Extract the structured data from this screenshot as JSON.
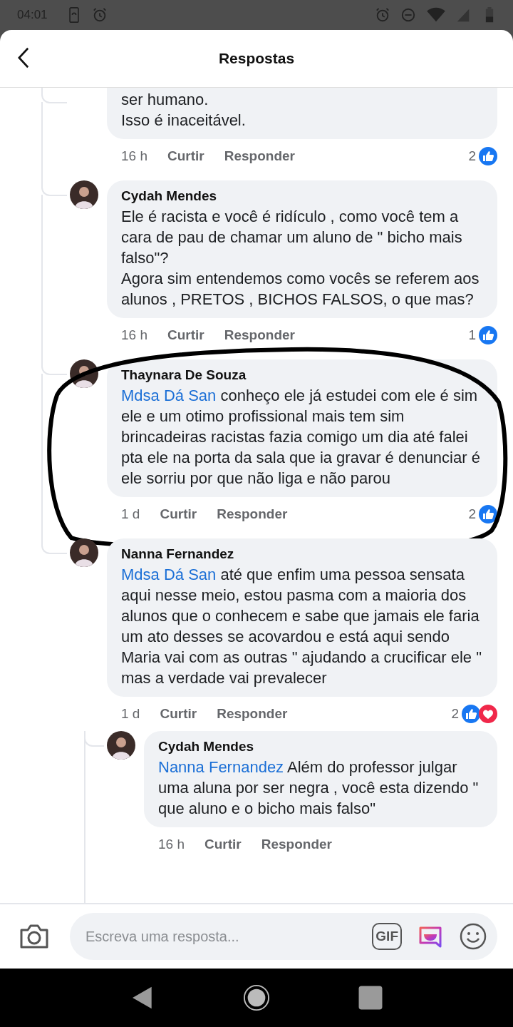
{
  "status_bar": {
    "time": "04:01"
  },
  "header": {
    "title": "Respostas"
  },
  "comments": [
    {
      "text": "ser humano.\nIsso é inaceitável.",
      "cut_top": true,
      "circled": false,
      "time": "16 h",
      "like": "Curtir",
      "reply": "Responder",
      "reaction_count": "2",
      "reactions": [
        {
          "kind": "like"
        }
      ]
    },
    {
      "author": "Cydah Mendes",
      "text": "Ele é racista e você é ridículo , como você tem a cara de pau de chamar um aluno de \" bicho mais falso\"?\nAgora sim entendemos como vocês se referem aos alunos , PRETOS , BICHOS FALSOS, o que mas?",
      "circled": false,
      "time": "16 h",
      "like": "Curtir",
      "reply": "Responder",
      "reaction_count": "1",
      "reactions": [
        {
          "kind": "like"
        }
      ]
    },
    {
      "author": "Thaynara De Souza",
      "mention": "Mdsa Dá San",
      "text": "conheço ele já estudei com ele é sim ele e um otimo profissional mais tem sim brincadeiras racistas fazia comigo um dia até falei pta ele na porta da sala que ia gravar é denunciar é ele sorriu por que não liga e não parou",
      "circled": true,
      "time": "1 d",
      "like": "Curtir",
      "reply": "Responder",
      "reaction_count": "2",
      "reactions": [
        {
          "kind": "like"
        }
      ]
    },
    {
      "author": "Nanna Fernandez",
      "mention": "Mdsa Dá San",
      "text": "até que enfim uma pessoa sensata aqui nesse meio, estou pasma com a maioria dos alunos que o conhecem e sabe que jamais ele faria um ato desses se acovardou e está aqui sendo Maria vai com as outras \" ajudando a crucificar ele \" mas a verdade vai prevalecer",
      "circled": false,
      "time": "1 d",
      "like": "Curtir",
      "reply": "Responder",
      "reaction_count": "2",
      "reactions": [
        {
          "kind": "like"
        },
        {
          "kind": "love"
        }
      ],
      "children": [
        {
          "author": "Cydah Mendes",
          "mention": "Nanna Fernandez",
          "text": "Além do professor julgar uma aluna por ser negra , você esta dizendo \" que aluno e o bicho mais falso\"",
          "circled": false,
          "time": "16 h",
          "like": "Curtir",
          "reply": "Responder"
        }
      ]
    }
  ],
  "composer": {
    "placeholder": "Escreva uma resposta...",
    "gif_label": "GIF"
  }
}
